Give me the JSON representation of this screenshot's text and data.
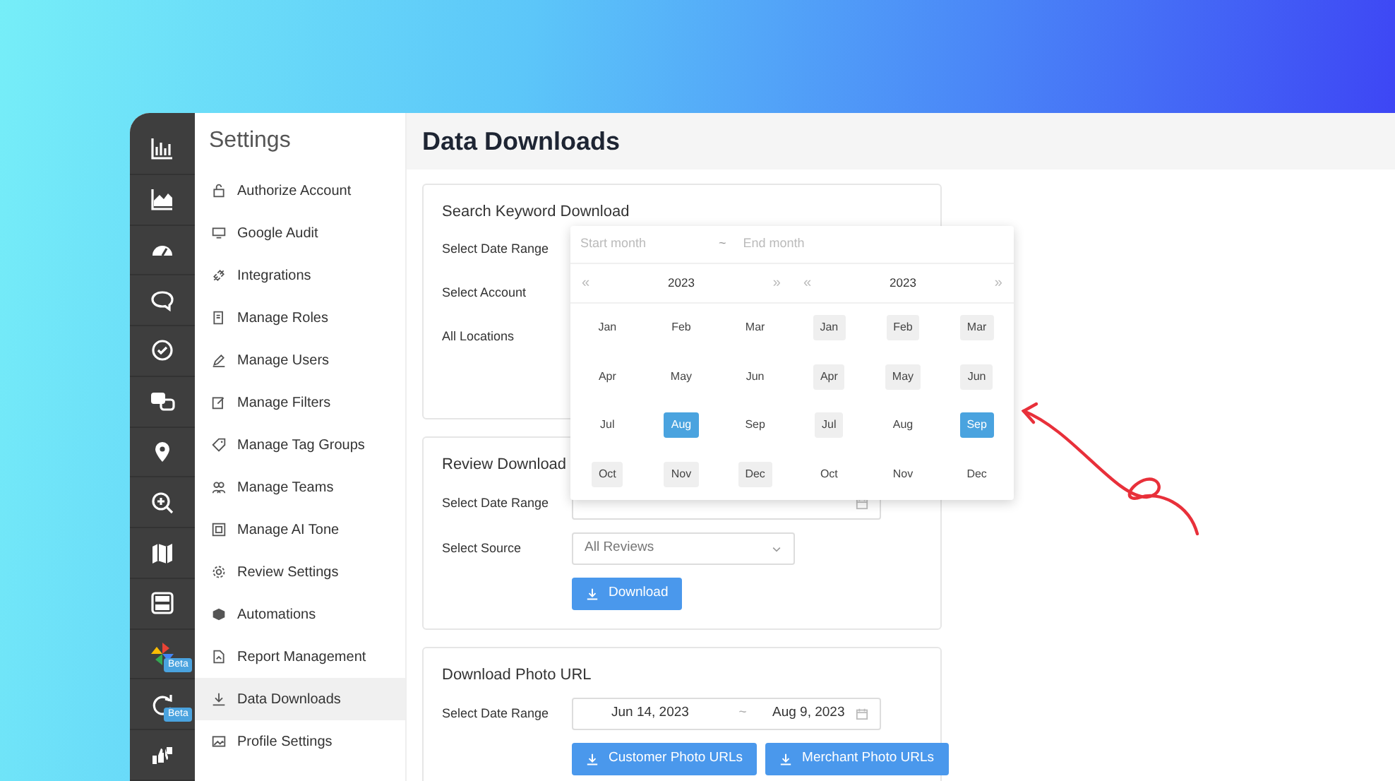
{
  "icon_rail": {
    "badges": [
      "Beta",
      "Beta"
    ]
  },
  "sidebar": {
    "title": "Settings",
    "items": [
      {
        "label": "Authorize Account",
        "selected": false
      },
      {
        "label": "Google Audit",
        "selected": false
      },
      {
        "label": "Integrations",
        "selected": false
      },
      {
        "label": "Manage Roles",
        "selected": false
      },
      {
        "label": "Manage Users",
        "selected": false
      },
      {
        "label": "Manage Filters",
        "selected": false
      },
      {
        "label": "Manage Tag Groups",
        "selected": false
      },
      {
        "label": "Manage Teams",
        "selected": false
      },
      {
        "label": "Manage AI Tone",
        "selected": false
      },
      {
        "label": "Review Settings",
        "selected": false
      },
      {
        "label": "Automations",
        "selected": false
      },
      {
        "label": "Report Management",
        "selected": false
      },
      {
        "label": "Data Downloads",
        "selected": true
      },
      {
        "label": "Profile Settings",
        "selected": false
      }
    ]
  },
  "page_title": "Data Downloads",
  "sections": [
    {
      "title": "Search Keyword Download",
      "fields": [
        {
          "kind": "label_only",
          "label": "Select Date Range"
        },
        {
          "kind": "label_only",
          "label": "Select Account"
        },
        {
          "kind": "label_only",
          "label": "All Locations"
        }
      ]
    },
    {
      "title": "Review Download",
      "fields": [
        {
          "kind": "date_range",
          "label": "Select Date Range"
        },
        {
          "kind": "select",
          "label": "Select Source",
          "value": "All Reviews"
        }
      ],
      "buttons": [
        "Download"
      ]
    },
    {
      "title": "Download Photo URL",
      "fields": [
        {
          "kind": "date_range",
          "label": "Select Date Range",
          "start": "Jun 14, 2023",
          "separator": "~",
          "end": "Aug 9, 2023"
        }
      ],
      "buttons": [
        "Customer Photo URLs",
        "Merchant Photo URLs"
      ]
    }
  ],
  "month_picker": {
    "start_placeholder": "Start month",
    "separator": "~",
    "end_placeholder": "End month",
    "panels": [
      {
        "prev": "«",
        "year": "2023",
        "next": "»",
        "months": [
          {
            "label": "Jan",
            "selected": false,
            "in_range": false
          },
          {
            "label": "Feb",
            "selected": false,
            "in_range": false
          },
          {
            "label": "Mar",
            "selected": false,
            "in_range": false
          },
          {
            "label": "Apr",
            "selected": false,
            "in_range": false
          },
          {
            "label": "May",
            "selected": false,
            "in_range": false
          },
          {
            "label": "Jun",
            "selected": false,
            "in_range": false
          },
          {
            "label": "Jul",
            "selected": false,
            "in_range": false
          },
          {
            "label": "Aug",
            "selected": true,
            "in_range": false
          },
          {
            "label": "Sep",
            "selected": false,
            "in_range": false
          },
          {
            "label": "Oct",
            "selected": false,
            "in_range": true
          },
          {
            "label": "Nov",
            "selected": false,
            "in_range": true
          },
          {
            "label": "Dec",
            "selected": false,
            "in_range": true
          }
        ]
      },
      {
        "prev": "«",
        "year": "2023",
        "next": "»",
        "months": [
          {
            "label": "Jan",
            "selected": false,
            "in_range": true
          },
          {
            "label": "Feb",
            "selected": false,
            "in_range": true
          },
          {
            "label": "Mar",
            "selected": false,
            "in_range": true
          },
          {
            "label": "Apr",
            "selected": false,
            "in_range": true
          },
          {
            "label": "May",
            "selected": false,
            "in_range": true
          },
          {
            "label": "Jun",
            "selected": false,
            "in_range": true
          },
          {
            "label": "Jul",
            "selected": false,
            "in_range": true
          },
          {
            "label": "Aug",
            "selected": false,
            "in_range": false
          },
          {
            "label": "Sep",
            "selected": true,
            "in_range": false
          },
          {
            "label": "Oct",
            "selected": false,
            "in_range": false
          },
          {
            "label": "Nov",
            "selected": false,
            "in_range": false
          },
          {
            "label": "Dec",
            "selected": false,
            "in_range": false
          }
        ]
      }
    ]
  }
}
